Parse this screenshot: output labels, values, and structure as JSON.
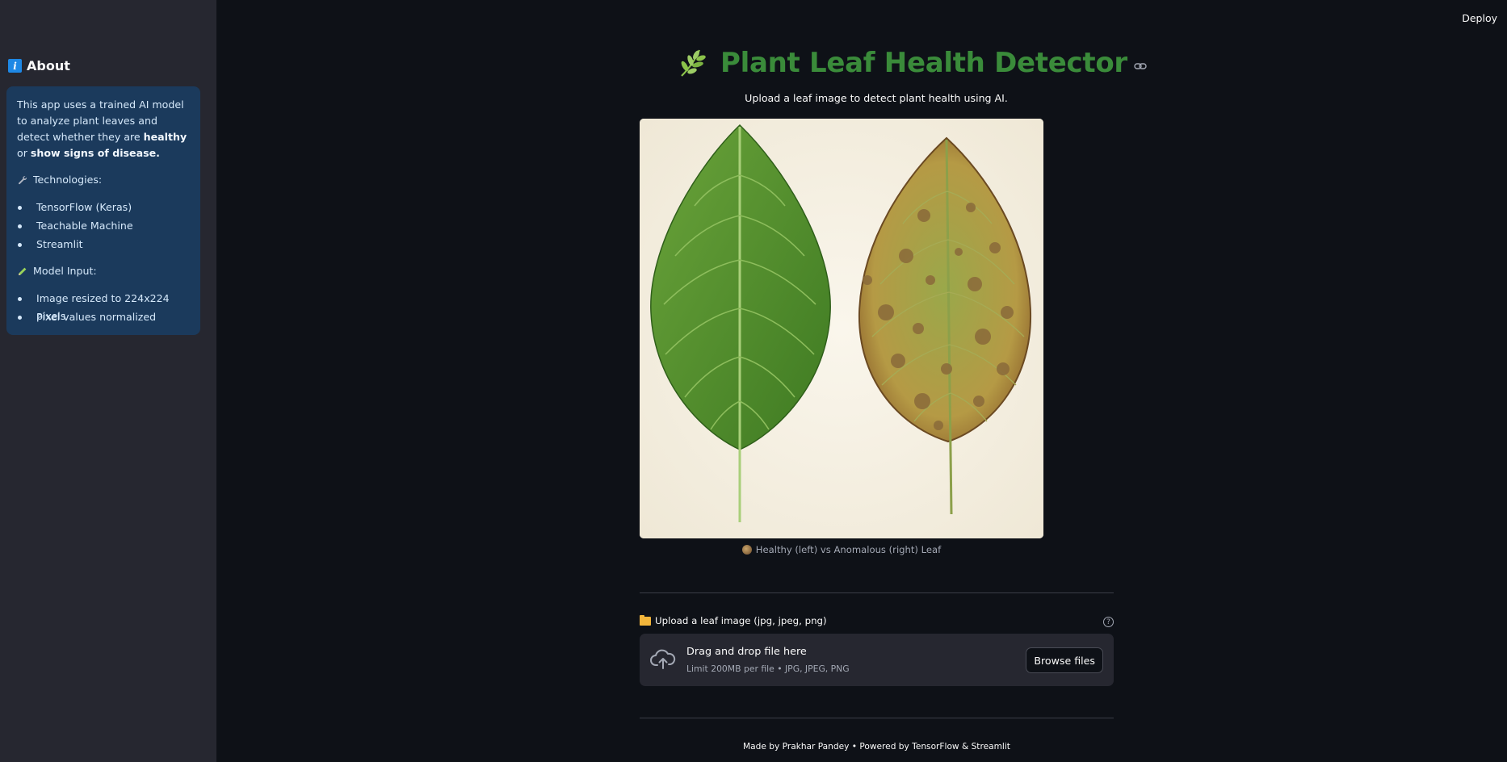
{
  "topbar": {
    "deploy_label": "Deploy"
  },
  "sidebar": {
    "title": "About",
    "description_prefix": "This app uses a trained AI model to analyze plant leaves and detect whether they are ",
    "description_bold1": "healthy",
    "description_mid": " or ",
    "description_bold2": "show signs of disease.",
    "technologies_heading": "Technologies:",
    "technologies": [
      "TensorFlow (Keras)",
      "Teachable Machine",
      "Streamlit"
    ],
    "model_input_heading": "Model Input:",
    "model_input": [
      "Image resized to 224x224 pixels",
      "Pixel values normalized"
    ]
  },
  "main": {
    "title": "Plant Leaf Health Detector",
    "subtitle": "Upload a leaf image to detect plant health using AI.",
    "image_caption": "Healthy (left) vs Anomalous (right) Leaf",
    "upload_label": "Upload a leaf image (jpg, jpeg, png)",
    "dropzone_title": "Drag and drop file here",
    "dropzone_limit": "Limit 200MB per file • JPG, JPEG, PNG",
    "browse_label": "Browse files",
    "footer": "Made by Prakhar Pandey • Powered by TensorFlow & Streamlit"
  },
  "colors": {
    "background": "#0e1117",
    "sidebar": "#262730",
    "info_box": "#1b3a5c",
    "title_green": "#3a8b3a"
  },
  "icons": [
    "info-icon",
    "wrench-icon",
    "pencil-icon",
    "herb-icon",
    "link-icon",
    "leaf-emoji-icon",
    "folder-icon",
    "help-icon",
    "cloud-upload-icon"
  ]
}
